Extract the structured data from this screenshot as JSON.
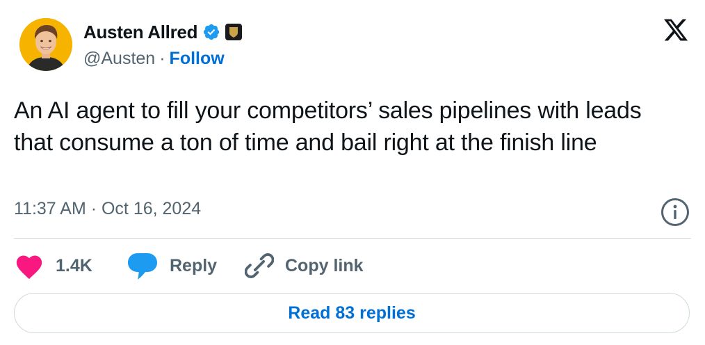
{
  "author": {
    "display_name": "Austen Allred",
    "handle": "@Austen",
    "separator": "·",
    "follow_label": "Follow"
  },
  "tweet": {
    "text": "An AI agent to fill your competitors’ sales pipelines with leads that consume a ton of time and bail right at the finish line",
    "timestamp": "11:37 AM · Oct 16, 2024"
  },
  "actions": {
    "like_count": "1.4K",
    "reply_label": "Reply",
    "copy_link_label": "Copy link"
  },
  "read_replies_label": "Read 83 replies",
  "colors": {
    "accent": "#006fd6",
    "like": "#f91880",
    "reply": "#1d9bf0",
    "muted": "#536471",
    "text": "#0f1419",
    "border": "#cfd9de",
    "avatar_bg": "#f6b400"
  },
  "icons": [
    "avatar",
    "verified-badge-icon",
    "affiliate-badge-icon",
    "x-logo-icon",
    "info-icon",
    "heart-icon",
    "reply-bubble-icon",
    "link-icon"
  ]
}
